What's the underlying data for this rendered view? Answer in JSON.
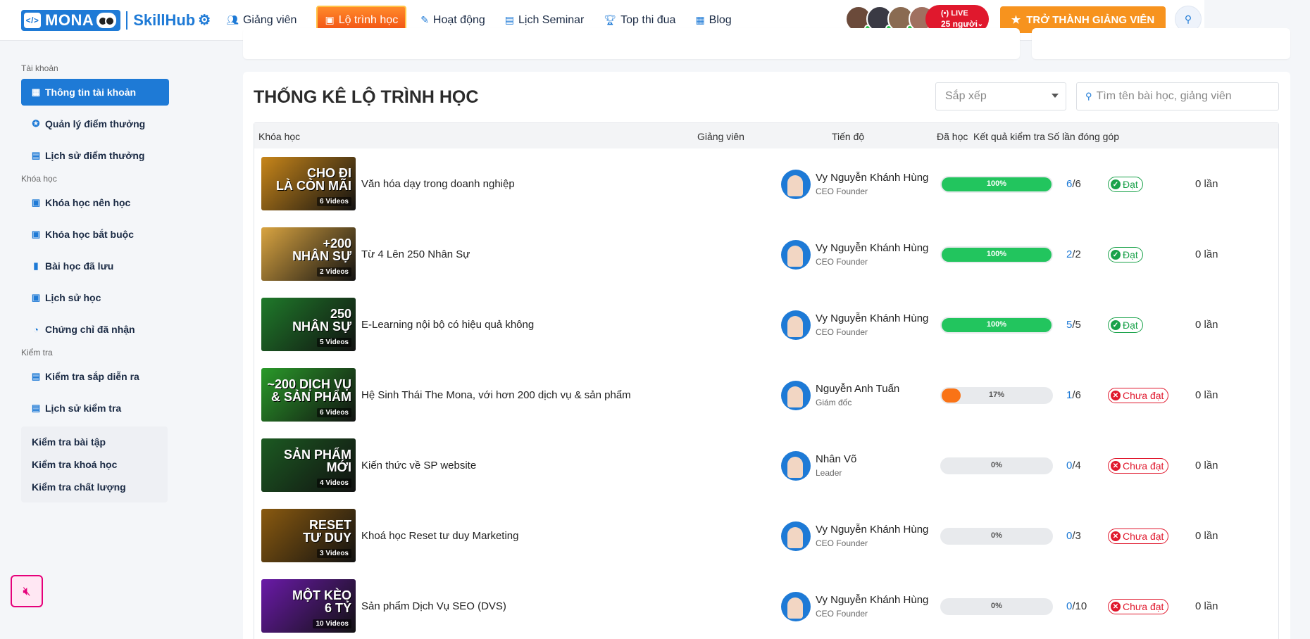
{
  "header": {
    "logo_mona": "MONA",
    "logo_skillhub": "SkillHub",
    "nav": [
      {
        "label": "Giảng viên",
        "icon": "users-icon"
      },
      {
        "label": "Lộ trình học",
        "icon": "roadmap-icon",
        "active": true
      },
      {
        "label": "Hoạt động",
        "icon": "activity-icon"
      },
      {
        "label": "Lịch Seminar",
        "icon": "calendar-icon"
      },
      {
        "label": "Top thi đua",
        "icon": "trophy-icon"
      },
      {
        "label": "Blog",
        "icon": "blog-icon"
      }
    ],
    "live": {
      "label": "(•) LIVE",
      "count": "25 người"
    },
    "cta": "TRỞ THÀNH GIẢNG VIÊN"
  },
  "sidebar": {
    "sections": [
      {
        "title": "Tài khoản",
        "items": [
          {
            "label": "Thông tin tài khoản",
            "active": true
          },
          {
            "label": "Quản lý điểm thưởng"
          },
          {
            "label": "Lịch sử điểm thưởng"
          }
        ]
      },
      {
        "title": "Khóa học",
        "items": [
          {
            "label": "Khóa học nên học"
          },
          {
            "label": "Khóa học bắt buộc"
          },
          {
            "label": "Bài học đã lưu"
          },
          {
            "label": "Lịch sử học"
          },
          {
            "label": "Chứng chỉ đã nhận"
          }
        ]
      },
      {
        "title": "Kiểm tra",
        "items": [
          {
            "label": "Kiểm tra sắp diễn ra"
          },
          {
            "label": "Lịch sử kiểm tra"
          }
        ]
      }
    ],
    "sub_items": [
      "Kiểm tra bài tập",
      "Kiểm tra khoá học",
      "Kiểm tra chất lượng"
    ]
  },
  "main": {
    "title": "THỐNG KÊ LỘ TRÌNH HỌC",
    "sort_placeholder": "Sắp xếp",
    "search_placeholder": "Tìm tên bài học, giảng viên",
    "columns": [
      "Khóa học",
      "Giảng viên",
      "Tiến độ",
      "Đã học",
      "Kết quả kiểm tra",
      "Số lần đóng góp"
    ],
    "rows": [
      {
        "thumb_text": "CHO ĐI\nLÀ CÒN MÃI",
        "videos": "6 Videos",
        "thumb_color": "#c8861a",
        "course": "Văn hóa dạy trong doanh nghiệp",
        "teacher": "Vy Nguyễn Khánh Hùng",
        "role": "CEO Founder",
        "progress": 100,
        "progress_label": "100%",
        "done": "6",
        "total": "/6",
        "result": "Đạt",
        "result_ok": true,
        "contrib": "0 lần"
      },
      {
        "thumb_text": "+200\nNHÂN SỰ",
        "videos": "2 Videos",
        "thumb_color": "#d9a441",
        "course": "Từ 4 Lên 250 Nhân Sự",
        "teacher": "Vy Nguyễn Khánh Hùng",
        "role": "CEO Founder",
        "progress": 100,
        "progress_label": "100%",
        "done": "2",
        "total": "/2",
        "result": "Đạt",
        "result_ok": true,
        "contrib": "0 lần"
      },
      {
        "thumb_text": "250\nNHÂN SỰ",
        "videos": "5 Videos",
        "thumb_color": "#1f7a2a",
        "course": "E-Learning nội bộ có hiệu quả không",
        "teacher": "Vy Nguyễn Khánh Hùng",
        "role": "CEO Founder",
        "progress": 100,
        "progress_label": "100%",
        "done": "5",
        "total": "/5",
        "result": "Đạt",
        "result_ok": true,
        "contrib": "0 lần"
      },
      {
        "thumb_text": "~200 DỊCH VỤ\n& SẢN PHẨM",
        "videos": "6 Videos",
        "thumb_color": "#2a9a2a",
        "course": "Hệ Sinh Thái The Mona, với hơn 200 dịch vụ & sản phẩm",
        "teacher": "Nguyễn Anh Tuấn",
        "role": "Giám đốc",
        "progress": 17,
        "progress_label": "17%",
        "done": "1",
        "total": "/6",
        "result": "Chưa đạt",
        "result_ok": false,
        "contrib": "0 lần"
      },
      {
        "thumb_text": "SẢN PHẨM\nMỚI",
        "videos": "4 Videos",
        "thumb_color": "#1c5a22",
        "course": "Kiến thức về SP website",
        "teacher": "Nhân Võ",
        "role": "Leader",
        "progress": 0,
        "progress_label": "0%",
        "done": "0",
        "total": "/4",
        "result": "Chưa đạt",
        "result_ok": false,
        "contrib": "0 lần"
      },
      {
        "thumb_text": "RESET\nTƯ DUY",
        "videos": "3 Videos",
        "thumb_color": "#8a5a10",
        "course": "Khoá học Reset tư duy Marketing",
        "teacher": "Vy Nguyễn Khánh Hùng",
        "role": "CEO Founder",
        "progress": 0,
        "progress_label": "0%",
        "done": "0",
        "total": "/3",
        "result": "Chưa đạt",
        "result_ok": false,
        "contrib": "0 lần"
      },
      {
        "thumb_text": "MỘT KÈO\n6 TỶ",
        "videos": "10 Videos",
        "thumb_color": "#6a1aa8",
        "course": "Sản phẩm Dịch Vụ SEO (DVS)",
        "teacher": "Vy Nguyễn Khánh Hùng",
        "role": "CEO Founder",
        "progress": 0,
        "progress_label": "0%",
        "done": "0",
        "total": "/10",
        "result": "Chưa đạt",
        "result_ok": false,
        "contrib": "0 lần"
      }
    ]
  },
  "colors": {
    "primary": "#1e7ad6",
    "accent": "#f7931e",
    "success": "#22c55e",
    "warning": "#f97316",
    "danger": "#e0182d"
  }
}
